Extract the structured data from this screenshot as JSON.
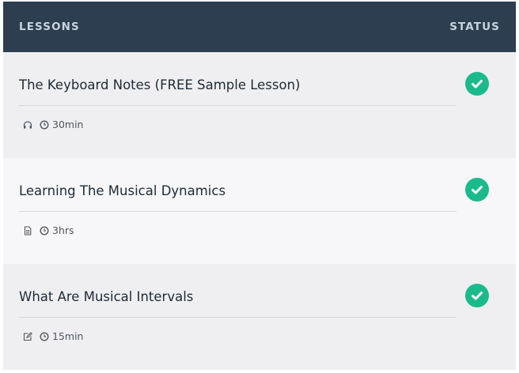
{
  "header": {
    "lessons_label": "LESSONS",
    "status_label": "STATUS"
  },
  "colors": {
    "header_bg": "#2d3e50",
    "check_green": "#1bba8c"
  },
  "lessons": [
    {
      "title": "The Keyboard Notes (FREE Sample Lesson)",
      "type_icon": "headphones-icon",
      "duration": "30min",
      "status": "completed"
    },
    {
      "title": "Learning The Musical Dynamics",
      "type_icon": "document-icon",
      "duration": "3hrs",
      "status": "completed"
    },
    {
      "title": "What Are Musical Intervals",
      "type_icon": "edit-icon",
      "duration": "15min",
      "status": "completed"
    }
  ]
}
